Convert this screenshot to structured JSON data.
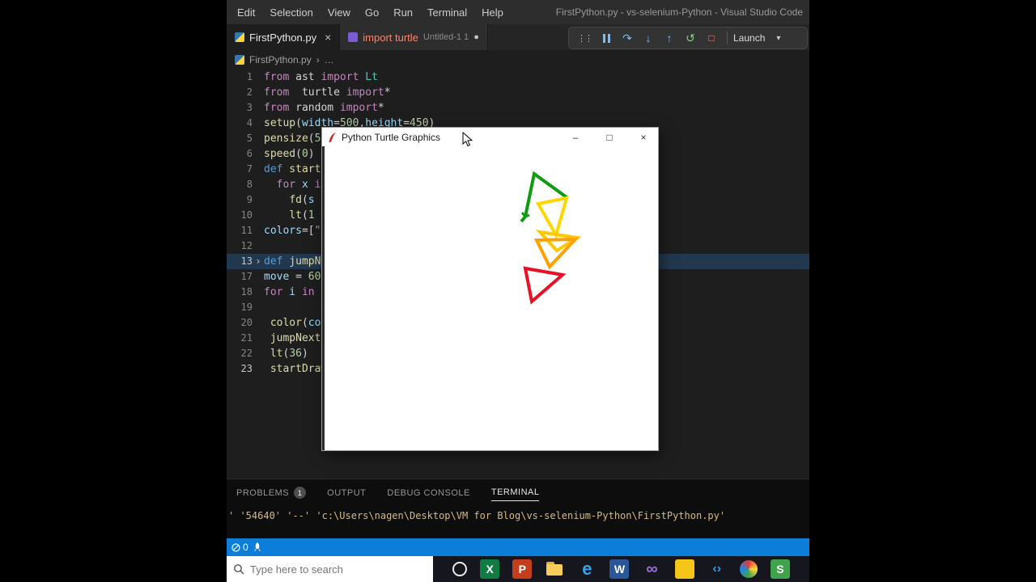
{
  "window_title": "FirstPython.py - vs-selenium-Python - Visual Studio Code",
  "menubar": [
    "Edit",
    "Selection",
    "View",
    "Go",
    "Run",
    "Terminal",
    "Help"
  ],
  "tabs": {
    "tab1": {
      "label": "FirstPython.py"
    },
    "tab2": {
      "label": "import turtle",
      "description": "Untitled-1 1"
    }
  },
  "debug_toolbar": {
    "launch": "Launch"
  },
  "breadcrumb": {
    "file": "FirstPython.py"
  },
  "icons": {
    "grip": "⋮⋮",
    "step_over": "↷",
    "step_into": "↓",
    "step_out": "↑",
    "restart": "↺",
    "stop": "□",
    "chevron_down": "▾",
    "close": "×",
    "minimize": "–",
    "maximize": "□",
    "dirty_dot": "●",
    "breadcrumb_sep": "›",
    "more": "…",
    "fold_collapsed": "›"
  },
  "editor": {
    "lines": [
      {
        "n": "1",
        "t": [
          [
            "from",
            "kw"
          ],
          [
            " ast ",
            "pl"
          ],
          [
            "import",
            "kw"
          ],
          [
            " Lt",
            "cls"
          ]
        ]
      },
      {
        "n": "2",
        "t": [
          [
            "from",
            "kw"
          ],
          [
            "  turtle ",
            "pl"
          ],
          [
            "import",
            "kw"
          ],
          [
            "*",
            "pl"
          ]
        ]
      },
      {
        "n": "3",
        "t": [
          [
            "from",
            "kw"
          ],
          [
            " random ",
            "pl"
          ],
          [
            "import",
            "kw"
          ],
          [
            "*",
            "pl"
          ]
        ]
      },
      {
        "n": "4",
        "t": [
          [
            "setup",
            "fn"
          ],
          [
            "(",
            "pl"
          ],
          [
            "width",
            "var"
          ],
          [
            "=",
            "pl"
          ],
          [
            "500",
            "num"
          ],
          [
            ",",
            "pl"
          ],
          [
            "height",
            "var"
          ],
          [
            "=",
            "pl"
          ],
          [
            "450",
            "num"
          ],
          [
            ")",
            "pl"
          ]
        ]
      },
      {
        "n": "5",
        "t": [
          [
            "pensize",
            "fn"
          ],
          [
            "(",
            "pl"
          ],
          [
            "5",
            "num"
          ]
        ]
      },
      {
        "n": "6",
        "t": [
          [
            "speed",
            "fn"
          ],
          [
            "(",
            "pl"
          ],
          [
            "0",
            "num"
          ],
          [
            ")",
            "pl"
          ]
        ]
      },
      {
        "n": "7",
        "t": [
          [
            "def",
            "def"
          ],
          [
            " startD",
            "fn"
          ]
        ]
      },
      {
        "n": "8",
        "t": [
          [
            "  ",
            "pl"
          ],
          [
            "for",
            "kw"
          ],
          [
            " x ",
            "var"
          ],
          [
            "in",
            "kw"
          ]
        ]
      },
      {
        "n": "9",
        "t": [
          [
            "    ",
            "pl"
          ],
          [
            "fd",
            "fn"
          ],
          [
            "(",
            "pl"
          ],
          [
            "s",
            "var"
          ]
        ]
      },
      {
        "n": "10",
        "t": [
          [
            "    ",
            "pl"
          ],
          [
            "lt",
            "fn"
          ],
          [
            "(",
            "pl"
          ],
          [
            "1",
            "num"
          ]
        ]
      },
      {
        "n": "11",
        "t": [
          [
            "colors",
            "var"
          ],
          [
            "=[",
            "pl"
          ],
          [
            "\"r",
            "str"
          ]
        ]
      },
      {
        "n": "12",
        "t": []
      },
      {
        "n": "13",
        "t": [
          [
            "def",
            "def"
          ],
          [
            " jumpNe",
            "fn"
          ]
        ],
        "fold": true,
        "hl": true,
        "bright": true
      },
      {
        "n": "17",
        "t": [
          [
            "move",
            "var"
          ],
          [
            " = ",
            "pl"
          ],
          [
            "60",
            "num"
          ]
        ]
      },
      {
        "n": "18",
        "t": [
          [
            "for",
            "kw"
          ],
          [
            " i ",
            "var"
          ],
          [
            "in",
            "kw"
          ],
          [
            " r",
            "pl"
          ]
        ]
      },
      {
        "n": "19",
        "t": []
      },
      {
        "n": "20",
        "t": [
          [
            " ",
            "pl"
          ],
          [
            "color",
            "fn"
          ],
          [
            "(",
            "pl"
          ],
          [
            "col",
            "var"
          ]
        ]
      },
      {
        "n": "21",
        "t": [
          [
            " ",
            "pl"
          ],
          [
            "jumpNext",
            "fn"
          ],
          [
            "(",
            "pl"
          ]
        ]
      },
      {
        "n": "22",
        "t": [
          [
            " ",
            "pl"
          ],
          [
            "lt",
            "fn"
          ],
          [
            "(",
            "pl"
          ],
          [
            "36",
            "num"
          ],
          [
            ")",
            "pl"
          ]
        ]
      },
      {
        "n": "23",
        "t": [
          [
            " ",
            "pl"
          ],
          [
            "startDraw",
            "fn"
          ]
        ],
        "bright": true
      }
    ]
  },
  "panel": {
    "tabs": [
      {
        "label": "PROBLEMS",
        "badge": "1"
      },
      {
        "label": "OUTPUT"
      },
      {
        "label": "DEBUG CONSOLE"
      },
      {
        "label": "TERMINAL"
      }
    ],
    "terminal_line": "' '54640' '--' 'c:\\Users\\nagen\\Desktop\\VM for Blog\\vs-selenium-Python\\FirstPython.py'"
  },
  "status_bar": {
    "error_count": "0"
  },
  "turtle_window": {
    "title": "Python Turtle Graphics",
    "colors": {
      "green": "#0d9c0d",
      "yellow": "#ffd700",
      "yellow2": "#ffc800",
      "orange": "#ffa000",
      "red": "#e81123"
    }
  },
  "taskbar": {
    "search_placeholder": "Type here to search",
    "icons": [
      {
        "name": "cortana-icon",
        "type": "ring"
      },
      {
        "name": "excel-icon",
        "glyph": "X",
        "bg": "#107c41",
        "fg": "#ffffff"
      },
      {
        "name": "powerpoint-icon",
        "glyph": "P",
        "bg": "#c43e1c",
        "fg": "#ffffff"
      },
      {
        "name": "file-explorer-icon",
        "type": "folder"
      },
      {
        "name": "edge-icon",
        "glyph": "e",
        "bg": "transparent",
        "fg": "#36a6ea",
        "size": 22
      },
      {
        "name": "word-icon",
        "glyph": "W",
        "bg": "#2b579a",
        "fg": "#ffffff"
      },
      {
        "name": "visual-studio-icon",
        "glyph": "∞",
        "bg": "transparent",
        "fg": "#9b6fd6",
        "size": 20
      },
      {
        "name": "sticky-notes-icon",
        "glyph": "",
        "bg": "#f5c518",
        "fg": "#7a5b00"
      },
      {
        "name": "vscode-icon",
        "glyph": "‹›",
        "bg": "transparent",
        "fg": "#2f9be6",
        "size": 16
      },
      {
        "name": "paint-icon",
        "type": "grad"
      },
      {
        "name": "snipping-icon",
        "glyph": "S",
        "bg": "#3fa34b",
        "fg": "#ffffff"
      }
    ]
  }
}
